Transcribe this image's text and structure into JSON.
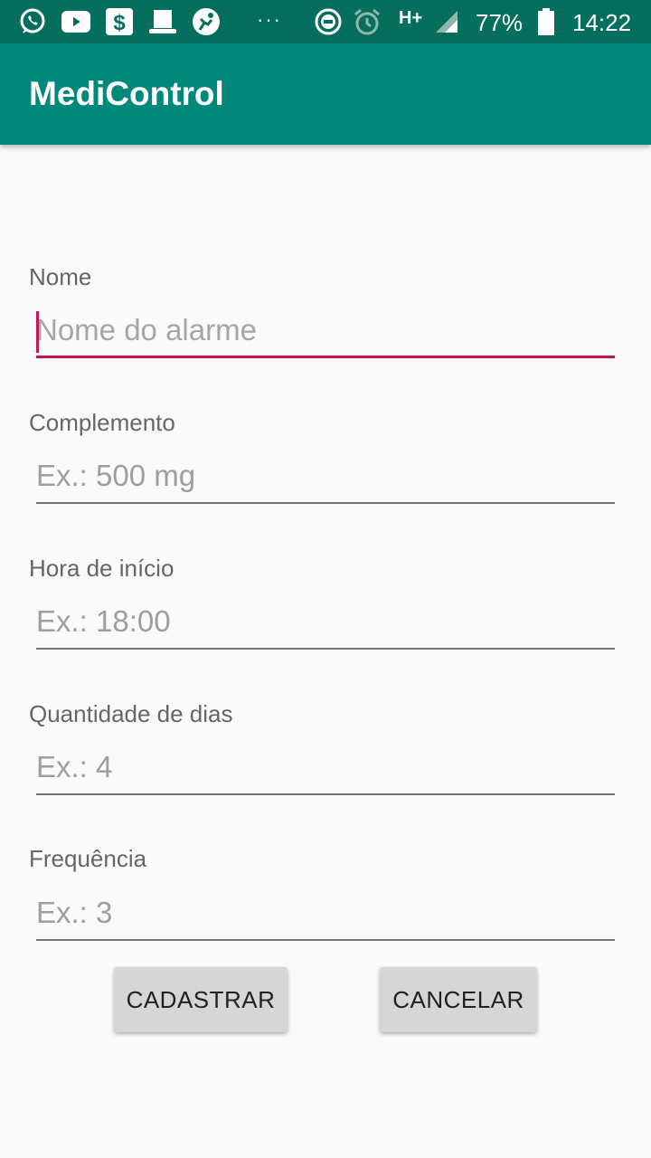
{
  "status_bar": {
    "icons": [
      "whatsapp-icon",
      "youtube-icon",
      "dollar-app-icon",
      "hat-icon",
      "soccer-app-icon",
      "more-notifications-icon",
      "do-not-disturb-icon",
      "alarm-icon",
      "signal-icon",
      "battery-icon"
    ],
    "dots": "···",
    "network": "H+",
    "battery": "77%",
    "time": "14:22"
  },
  "app_bar": {
    "title": "MediControl",
    "color": "#00897b"
  },
  "form": {
    "fields": [
      {
        "label": "Nome",
        "placeholder": "Nome do alarme",
        "value": ""
      },
      {
        "label": "Complemento",
        "placeholder": "Ex.: 500 mg",
        "value": ""
      },
      {
        "label": "Hora de início",
        "placeholder": "Ex.: 18:00",
        "value": ""
      },
      {
        "label": "Quantidade de dias",
        "placeholder": "Ex.: 4",
        "value": ""
      },
      {
        "label": "Frequência",
        "placeholder": "Ex.: 3",
        "value": ""
      }
    ],
    "accent_color": "#c2185b"
  },
  "actions": {
    "register_label": "CADASTRAR",
    "cancel_label": "CANCELAR"
  }
}
